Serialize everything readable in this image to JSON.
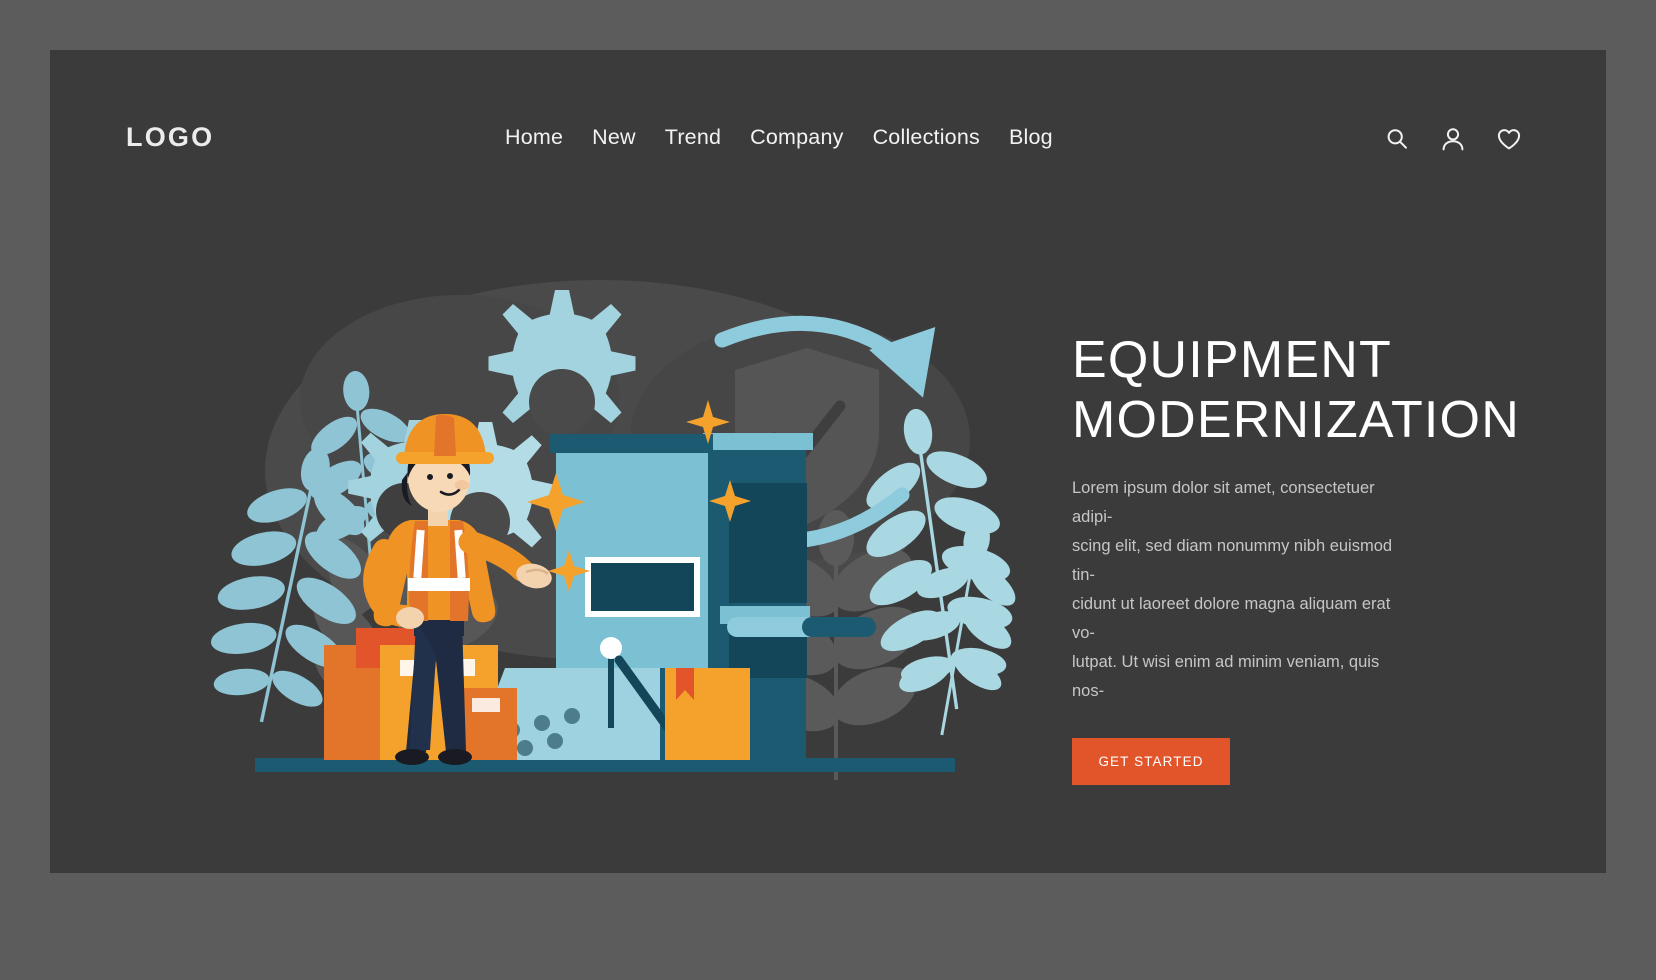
{
  "theme": {
    "outer_background": "#5c5c5c",
    "card_background": "#3b3b3b",
    "accent_orange": "#e2552a",
    "text_light": "#ffffff",
    "text_muted": "#c6c6c6",
    "illustration_light_blue": "#9ed2e0",
    "illustration_mid_blue": "#6cb5cc",
    "illustration_dark_teal": "#1b5a71",
    "illustration_orange": "#f5a22d",
    "illustration_deep_orange": "#e2552a",
    "illustration_navy": "#1f2b42"
  },
  "header": {
    "logo": "LOGO",
    "nav": [
      {
        "label": "Home"
      },
      {
        "label": "New"
      },
      {
        "label": "Trend"
      },
      {
        "label": "Company"
      },
      {
        "label": "Collections"
      },
      {
        "label": "Blog"
      }
    ],
    "icons": [
      {
        "name": "search-icon",
        "label": "Search"
      },
      {
        "name": "user-icon",
        "label": "Account"
      },
      {
        "name": "heart-icon",
        "label": "Favorites"
      }
    ]
  },
  "hero": {
    "headline": "EQUIPMENT\nMODERNIZATION",
    "paragraph": "Lorem ipsum dolor sit amet, consectetuer adipi-\nscing elit, sed diam nonummy nibh euismod tin-\ncidunt ut laoreet dolore magna aliquam erat vo-\nlutpat. Ut wisi enim ad minim veniam, quis nos-",
    "cta_label": "GET STARTED"
  },
  "illustration": {
    "alt": "Factory worker in orange hard hat and safety vest beside a modern industrial machine with gears, cycle arrows, security shield with checkmark, cardboard boxes and foliage",
    "elements": [
      "worker-figure",
      "machine",
      "control-console",
      "gear-large",
      "gear-medium",
      "gear-small",
      "cycle-arrows",
      "shield-check",
      "cardboard-boxes",
      "foliage-branches",
      "sparkles"
    ]
  }
}
